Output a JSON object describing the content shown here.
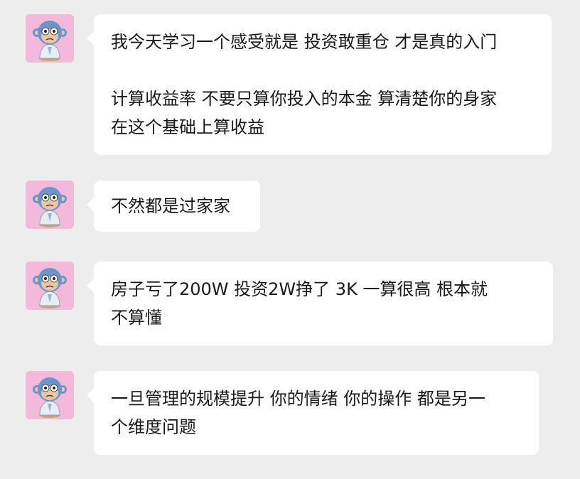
{
  "messages": [
    {
      "sender_avatar": "monkey-avatar",
      "lines": [
        "我今天学习一个感受就是 投资敢重仓 才是真的入门",
        "",
        "计算收益率 不要只算你投入的本金 算清楚你的身家",
        "在这个基础上算收益"
      ]
    },
    {
      "sender_avatar": "monkey-avatar",
      "lines": [
        "不然都是过家家"
      ]
    },
    {
      "sender_avatar": "monkey-avatar",
      "lines": [
        "房子亏了200W 投资2W挣了 3K 一算很高 根本就",
        "不算懂"
      ]
    },
    {
      "sender_avatar": "monkey-avatar",
      "lines": [
        "一旦管理的规模提升 你的情绪 你的操作 都是另一",
        "个维度问题"
      ]
    }
  ]
}
